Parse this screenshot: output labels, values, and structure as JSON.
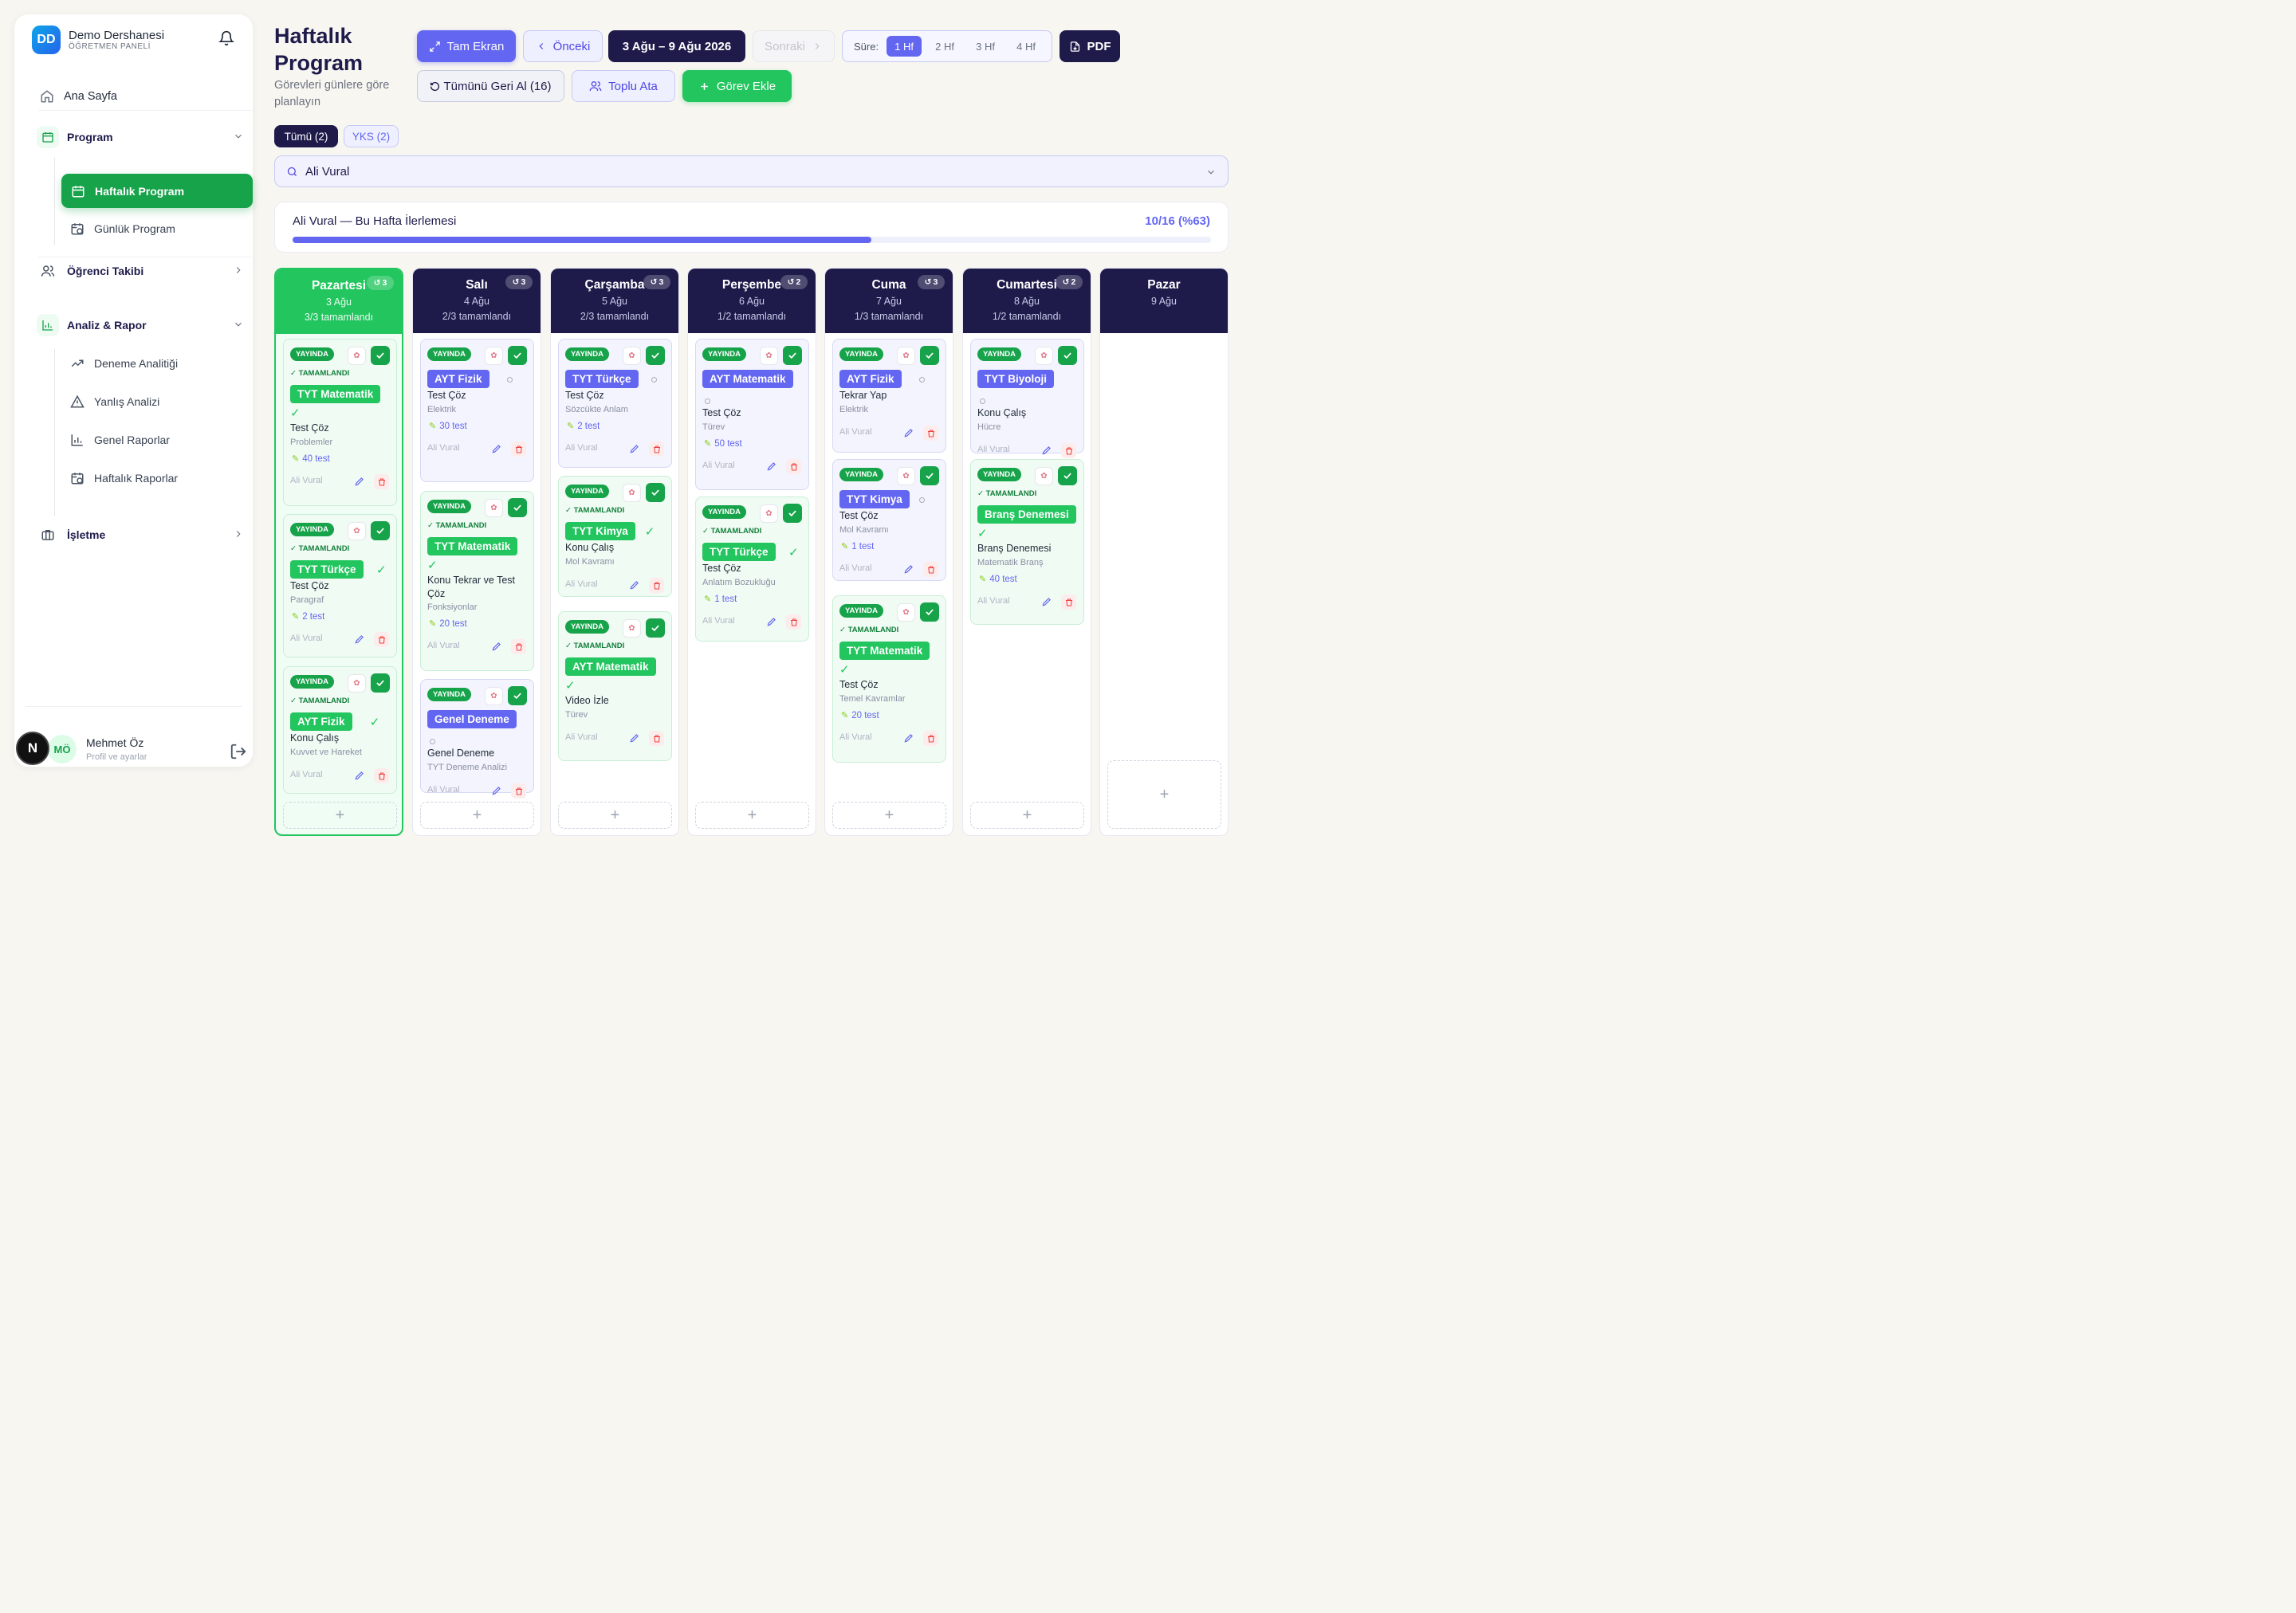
{
  "app": {
    "logo": "DD",
    "name": "Demo Dershanesi",
    "panel": "ÖĞRETMEN PANELİ"
  },
  "nav": {
    "home": "Ana Sayfa",
    "program": "Program",
    "weekly": "Haftalık Program",
    "daily": "Günlük Program",
    "tracking": "Öğrenci Takibi",
    "analysis": "Analiz & Rapor",
    "exam": "Deneme Analitiği",
    "mistakes": "Yanlış Analizi",
    "general": "Genel Raporlar",
    "weekly_reports": "Haftalık Raporlar",
    "business": "İşletme"
  },
  "user": {
    "initials": "MÖ",
    "name": "Mehmet Öz",
    "profile": "Profil ve ayarlar"
  },
  "overlay": {
    "next_badge": "N"
  },
  "page": {
    "title": "Haftalık Program",
    "subtitle": "Görevleri günlere göre planlayın"
  },
  "toolbar": {
    "fullscreen": "Tam Ekran",
    "prev": "Önceki",
    "range": "3 Ağu – 9 Ağu 2026",
    "next": "Sonraki",
    "duration_label": "Süre:",
    "durations": [
      "1 Hf",
      "2 Hf",
      "3 Hf",
      "4 Hf"
    ],
    "pdf": "PDF",
    "undo_all": "Tümünü Geri Al (16)",
    "bulk": "Toplu Ata",
    "add_task": "Görev Ekle"
  },
  "filters": {
    "all": "Tümü (2)",
    "yks": "YKS (2)"
  },
  "student": {
    "selected": "Ali Vural"
  },
  "progress": {
    "label": "Ali Vural — Bu Hafta İlerlemesi",
    "value": "10/16 (%63)",
    "fraction": 0.63
  },
  "colors": {
    "primary": "#6366f1",
    "success": "#16a34a",
    "dark": "#1e1b4b"
  },
  "days": [
    {
      "name": "Pazartesi",
      "date": "3 Ağu",
      "status": "3/3 tamamlandı",
      "undo": "3"
    },
    {
      "name": "Salı",
      "date": "4 Ağu",
      "status": "2/3 tamamlandı",
      "undo": "3"
    },
    {
      "name": "Çarşamba",
      "date": "5 Ağu",
      "status": "2/3 tamamlandı",
      "undo": "3"
    },
    {
      "name": "Perşembe",
      "date": "6 Ağu",
      "status": "1/2 tamamlandı",
      "undo": "2"
    },
    {
      "name": "Cuma",
      "date": "7 Ağu",
      "status": "1/3 tamamlandı",
      "undo": "3"
    },
    {
      "name": "Cumartesi",
      "date": "8 Ağu",
      "status": "1/2 tamamlandı",
      "undo": "2"
    },
    {
      "name": "Pazar",
      "date": "9 Ağu",
      "status": "",
      "undo": ""
    }
  ],
  "labels": {
    "published": "YAYINDA",
    "completed": "✓ TAMAMLANDI",
    "student": "Ali Vural"
  },
  "tasks": [
    [
      {
        "subject": "TYT Matematik",
        "type": "Test Çöz",
        "topic": "Problemler",
        "count": "40 test"
      },
      {
        "subject": "TYT Türkçe",
        "type": "Test Çöz",
        "topic": "Paragraf",
        "count": "2 test"
      },
      {
        "subject": "AYT Fizik",
        "type": "Konu Çalış",
        "topic": "Kuvvet ve Hareket",
        "count": ""
      }
    ],
    [
      {
        "subject": "AYT Fizik",
        "type": "Test Çöz",
        "topic": "Elektrik",
        "count": "30 test"
      },
      {
        "subject": "TYT Matematik",
        "type": "Konu Tekrar ve Test Çöz",
        "topic": "Fonksiyonlar",
        "count": "20 test"
      },
      {
        "subject": "Genel Deneme",
        "type": "Genel Deneme",
        "topic": "TYT Deneme Analizi",
        "count": ""
      }
    ],
    [
      {
        "subject": "TYT Türkçe",
        "type": "Test Çöz",
        "topic": "Sözcükte Anlam",
        "count": "2 test"
      },
      {
        "subject": "TYT Kimya",
        "type": "Konu Çalış",
        "topic": "Mol Kavramı",
        "count": ""
      },
      {
        "subject": "AYT Matematik",
        "type": "Video İzle",
        "topic": "Türev",
        "count": ""
      }
    ],
    [
      {
        "subject": "AYT Matematik",
        "type": "Test Çöz",
        "topic": "Türev",
        "count": "50 test"
      },
      {
        "subject": "TYT Türkçe",
        "type": "Test Çöz",
        "topic": "Anlatım Bozukluğu",
        "count": "1 test"
      }
    ],
    [
      {
        "subject": "AYT Fizik",
        "type": "Tekrar Yap",
        "topic": "Elektrik",
        "count": ""
      },
      {
        "subject": "TYT Kimya",
        "type": "Test Çöz",
        "topic": "Mol Kavramı",
        "count": "1 test"
      },
      {
        "subject": "TYT Matematik",
        "type": "Test Çöz",
        "topic": "Temel Kavramlar",
        "count": "20 test"
      }
    ],
    [
      {
        "subject": "TYT Biyoloji",
        "type": "Konu Çalış",
        "topic": "Hücre",
        "count": ""
      },
      {
        "subject": "Branş Denemesi",
        "type": "Branş Denemesi",
        "topic": "Matematik Branş",
        "count": "40 test"
      }
    ]
  ]
}
